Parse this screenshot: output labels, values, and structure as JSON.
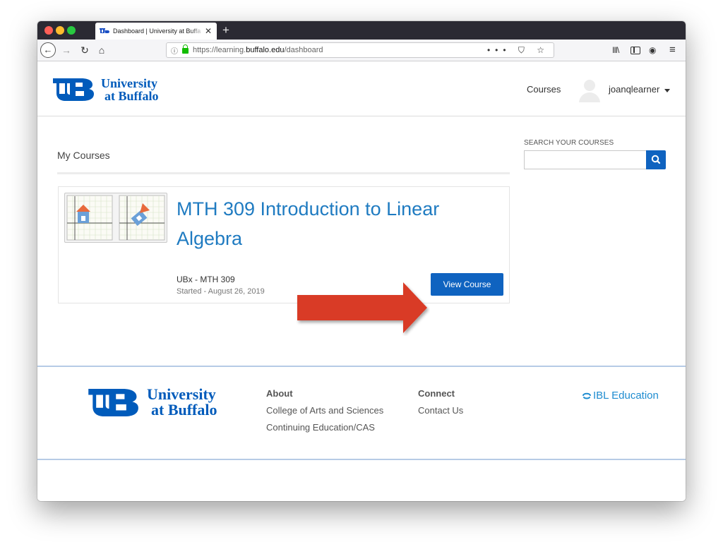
{
  "browser": {
    "tab_title": "Dashboard | University at Buffa",
    "new_tab_symbol": "+",
    "close_symbol": "✕",
    "url_prefix": "https://learning.",
    "url_domain": "buffalo.edu",
    "url_path": "/dashboard",
    "url_actions": "••• ⛉ ☆",
    "library_symbol": "III\\",
    "account_symbol": "◉",
    "menu_symbol": "≡",
    "back_symbol": "←",
    "forward_symbol": "→",
    "reload_symbol": "↻",
    "home_symbol": "⌂",
    "info_symbol": "ⓘ"
  },
  "header": {
    "logo_line1": "University",
    "logo_line2": "at Buffalo",
    "nav_courses": "Courses",
    "username": "joanqlearner"
  },
  "main": {
    "section_title": "My Courses",
    "search_label": "SEARCH YOUR COURSES",
    "search_value": "",
    "course": {
      "title": "MTH 309 Introduction to Linear Algebra",
      "code": "UBx - MTH 309",
      "started": "Started - August 26, 2019",
      "button_label": "View Course"
    }
  },
  "footer": {
    "logo_line1": "University",
    "logo_line2": "at Buffalo",
    "about_heading": "About",
    "about_links": [
      "College of Arts and Sciences",
      "Continuing Education/CAS"
    ],
    "connect_heading": "Connect",
    "connect_links": [
      "Contact Us"
    ],
    "ibl_logo_text": "IBL Education"
  },
  "colors": {
    "ub_blue": "#005bbb",
    "button_blue": "#0f63c0",
    "course_title_blue": "#1f7bc1",
    "arrow_red": "#d93a26",
    "ibl_blue": "#1e8cd0"
  },
  "icons": {
    "search": "search-icon",
    "user": "avatar-icon",
    "caret": "chevron-down-icon",
    "lock": "lock-icon"
  }
}
